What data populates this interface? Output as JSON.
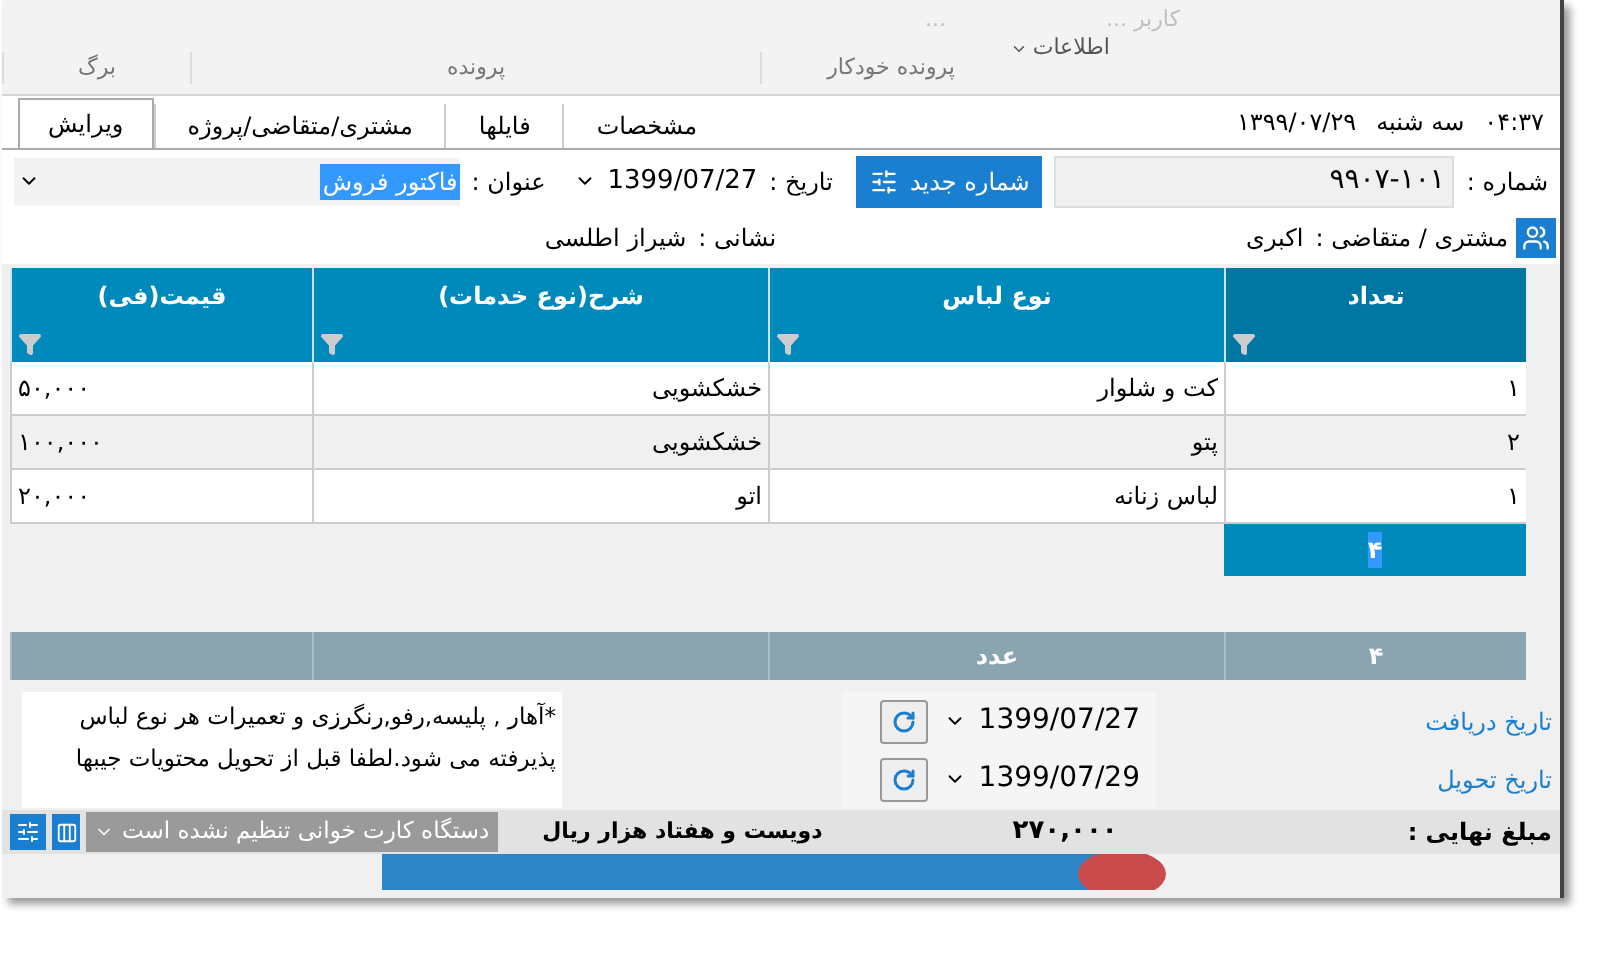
{
  "ribbon": {
    "cut_labels": [
      "کاربر ...",
      "..."
    ],
    "info_menu": "اطلاعات",
    "groups": [
      "پرونده خودکار",
      "پرونده",
      "برگ"
    ]
  },
  "clock": {
    "time": "۰۴:۳۷",
    "weekday": "سه شنبه",
    "date": "۱۳۹۹/۰۷/۲۹"
  },
  "tabs": [
    {
      "label": "مشخصات",
      "selected": false
    },
    {
      "label": "فایلها",
      "selected": false
    },
    {
      "label": "مشتری/متقاضی/پروژه",
      "selected": false
    },
    {
      "label": "ویرایش",
      "selected": true
    }
  ],
  "form": {
    "number_label": "شماره :",
    "number": "۹۹۰۷-۱۰۱",
    "new_number_button": "شماره جدید",
    "date_label": "تاریخ :",
    "date": "1399/07/27",
    "title_label": "عنوان :",
    "title": "فاکتور فروش"
  },
  "customer": {
    "label": "مشتری / متقاضی :",
    "value": "اکبری",
    "address_label": "نشانی :",
    "address": "شیراز اطلسی"
  },
  "table": {
    "columns": [
      {
        "label": "تعداد",
        "selected": true
      },
      {
        "label": "نوع لباس",
        "selected": false
      },
      {
        "label": "شرح(نوع خدمات)",
        "selected": false
      },
      {
        "label": "قیمت(فی)",
        "selected": false
      }
    ],
    "rows": [
      [
        "۱",
        "کت و شلوار",
        "خشکشویی",
        "۵۰,۰۰۰"
      ],
      [
        "۲",
        "پتو",
        "خشکشویی",
        "۱۰۰,۰۰۰"
      ],
      [
        "۱",
        "لباس زنانه",
        "اتو",
        "۲۰,۰۰۰"
      ]
    ],
    "edit_cell": "۴",
    "footer": [
      "۴",
      "عدد"
    ]
  },
  "dates": [
    {
      "label": "تاریخ دریافت",
      "value": "1399/07/27"
    },
    {
      "label": "تاریخ تحویل",
      "value": "1399/07/29"
    }
  ],
  "note_lines": [
    "*آهار , پلیسه,رفو,رنگرزی و تعمیرات هر نوع لباس",
    "پذیرفته می شود.لطفا قبل از تحویل محتویات جیبها"
  ],
  "status": {
    "total_label": "مبلغ نهایی :",
    "total": "۲۷۰,۰۰۰",
    "amount_words": "دویست و هفتاد هزار ریال",
    "card_reader": "دستگاه کارت خوانی تنظیم نشده است"
  }
}
